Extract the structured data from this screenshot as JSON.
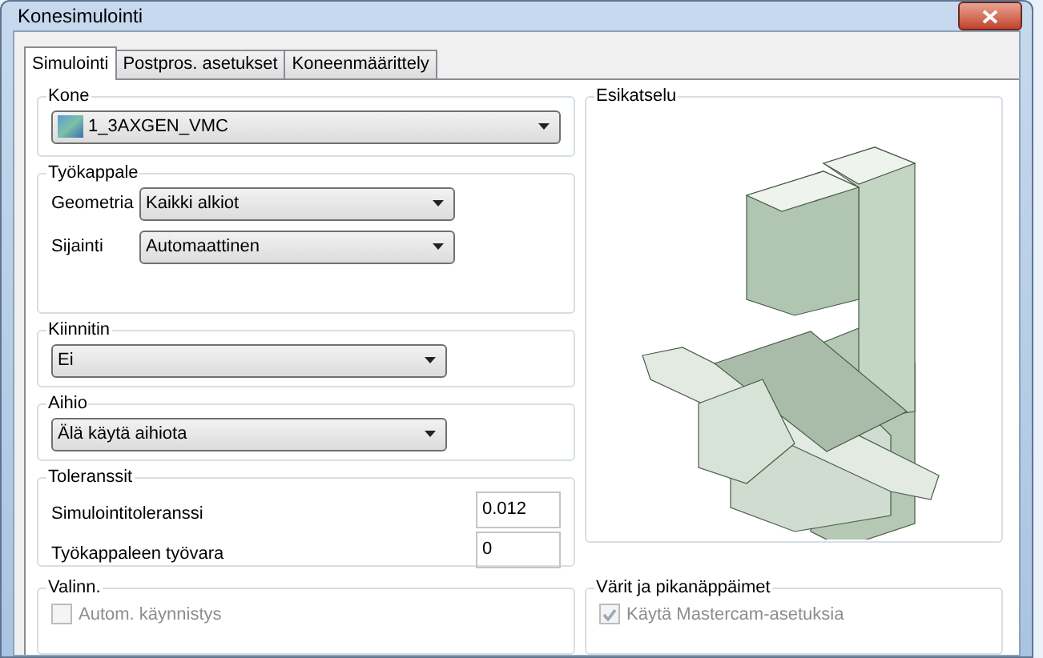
{
  "window": {
    "title": "Konesimulointi"
  },
  "tabs": [
    {
      "label": "Simulointi",
      "selected": true
    },
    {
      "label": "Postpros. asetukset",
      "selected": false
    },
    {
      "label": "Koneenmäärittely",
      "selected": false
    }
  ],
  "machine": {
    "legend": "Kone",
    "value": "1_3AXGEN_VMC"
  },
  "workpiece": {
    "legend": "Työkappale",
    "rows": [
      {
        "label": "Geometria",
        "value": "Kaikki alkiot"
      },
      {
        "label": "Sijainti",
        "value": "Automaattinen"
      }
    ]
  },
  "fixture": {
    "legend": "Kiinnitin",
    "value": "Ei"
  },
  "stock": {
    "legend": "Aihio",
    "value": "Älä käytä aihiota"
  },
  "tolerances": {
    "legend": "Toleranssit",
    "rows": [
      {
        "label": "Simulointitoleranssi",
        "value": "0.012"
      },
      {
        "label": "Työkappaleen työvara",
        "value": "0"
      }
    ]
  },
  "options": {
    "legend": "Valinn.",
    "checkboxes": [
      {
        "label": "Autom. käynnistys",
        "checked": false,
        "disabled": true
      }
    ]
  },
  "preview": {
    "legend": "Esikatselu"
  },
  "colors": {
    "legend": "Värit ja pikanäppäimet",
    "checkboxes": [
      {
        "label": "Käytä Mastercam-asetuksia",
        "checked": true,
        "disabled": true
      }
    ]
  }
}
